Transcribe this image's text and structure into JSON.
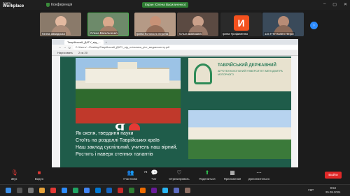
{
  "app": {
    "logo_line1": "zoom",
    "logo_line2": "Workplace",
    "conference_label": "Конференція",
    "screen_share_label": "Екран (Олена Васильченко)"
  },
  "participants": [
    {
      "name": "Ганна Завадська"
    },
    {
      "name": "Олена Васильченко"
    },
    {
      "name": "Ірина Колоколь-верина"
    },
    {
      "name": "Ольга Шалашна"
    },
    {
      "name": "Ірина Трофименко",
      "avatar_letter": "И"
    },
    {
      "name": "115 ГПУ Колен Петро"
    }
  ],
  "browser": {
    "tab_label": "Таврійський_ДАТУ_від_...",
    "url": "C:/Users/.../Desktop/Таврійський_ДАТУ_від_очільника_ріст_медикоштету.pdf",
    "tool_label": "Нарисовать",
    "page_info": "2 из 20"
  },
  "slide": {
    "university_title": "ТАВРІЙСЬКИЙ ДЕРЖАВНИЙ",
    "university_sub": "АГРОТЕХНОЛОГІЧНИЙ УНІВЕРСИТЕТ ІМЕНІ ДМИТРА МОТОРНОГО",
    "ya_letter": "Я",
    "poem": [
      "Як скеля, твердиня науки",
      "Стоїть на роздоллі Таврійських країв",
      "Наш заклад суспільний, учитель наш вірний,",
      "Ростить і наверх степних талантів"
    ]
  },
  "toolbar": {
    "audio": "Звук",
    "video": "Видео",
    "participants": "Участники",
    "participants_count": "73",
    "chat": "Чат",
    "reactions": "Отреагировать",
    "share": "Поделиться",
    "apps": "Приложения",
    "more": "Дополнительно",
    "end": "Выйти"
  },
  "taskbar": {
    "time": "9:53",
    "date": "25.09.2024",
    "lang": "УКР"
  }
}
